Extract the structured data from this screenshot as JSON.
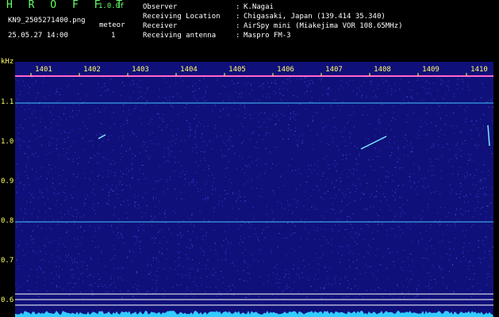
{
  "header": {
    "app_title": "H R O F F T",
    "version": "1.0.0f",
    "file_name": "KN9_2505271400.png",
    "mode_label": "meteor",
    "mode_value": "1",
    "date_time": "25.05.27 14:00"
  },
  "metadata": [
    {
      "key": "Observer",
      "value": "K.Nagai"
    },
    {
      "key": "Receiving Location",
      "value": "Chigasaki, Japan (139.414 35.340)"
    },
    {
      "key": "Receiver",
      "value": "AirSpy mini (Miakejima VOR 108.65MHz)"
    },
    {
      "key": "Receiving antenna",
      "value": "Maspro FM-3"
    }
  ],
  "plot": {
    "unit_label": "kHz",
    "time_ticks": [
      "1401",
      "1402",
      "1403",
      "1404",
      "1405",
      "1406",
      "1407",
      "1408",
      "1409",
      "1410"
    ],
    "freq_ticks": [
      "1.1",
      "1.0",
      "0.9",
      "0.8",
      "0.7",
      "0.6"
    ],
    "colors": {
      "background": "#10107a",
      "noise_bright": "#3a3ae0",
      "line_cyan": "#40c8ff",
      "line_top": "#ff66cc",
      "tick_text": "#ffff66",
      "baseline": "#33ccff"
    }
  }
}
